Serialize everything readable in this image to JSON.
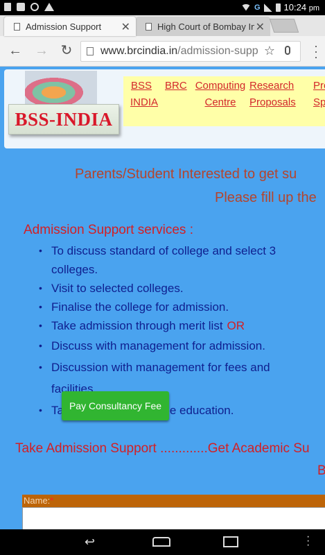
{
  "status_bar": {
    "time": "10:24",
    "time_suffix": "pm",
    "network": "G"
  },
  "tabs": [
    {
      "title": "Admission Support",
      "active": true
    },
    {
      "title": "High Court of Bombay Int",
      "active": false
    }
  ],
  "toolbar": {
    "url_host": "www.brcindia.in",
    "url_path": "/admission-supp"
  },
  "site": {
    "logo_text": "BSS-INDIA",
    "menu": [
      {
        "line1": "BSS",
        "line2": "INDIA"
      },
      {
        "line1": "BRC",
        "line2": ""
      },
      {
        "line1": "Computing",
        "line2": "Centre"
      },
      {
        "line1": "Research",
        "line2": "Proposals"
      },
      {
        "line1": "Pro",
        "line2": "Spons"
      }
    ]
  },
  "intro": {
    "line1": "Parents/Student Interested to get su",
    "line2": "Please fill up the"
  },
  "services": {
    "heading": "Admission Support services :",
    "items": [
      "To discuss standard of college and select 3 colleges.",
      "Visit to selected colleges.",
      "Finalise the college for admission.",
      "Take admission through merit list",
      "Discuss with management for admission.",
      "Discussion with management for fees and facilities.",
      "Ta",
      "ntinue education."
    ],
    "or_label": "OR"
  },
  "pay_button": "Pay Consultancy Fee",
  "bottom_text": "Take Admission Support .............Get Academic Su",
  "bottom_b": "B",
  "form": {
    "name_label": "Name:",
    "required_mark": "*"
  },
  "colors": {
    "page_bg": "#4aa3ef",
    "accent_red": "#d31f24",
    "list_blue": "#0f1f8f",
    "button_green": "#31b531",
    "label_bar": "#bd6408"
  }
}
